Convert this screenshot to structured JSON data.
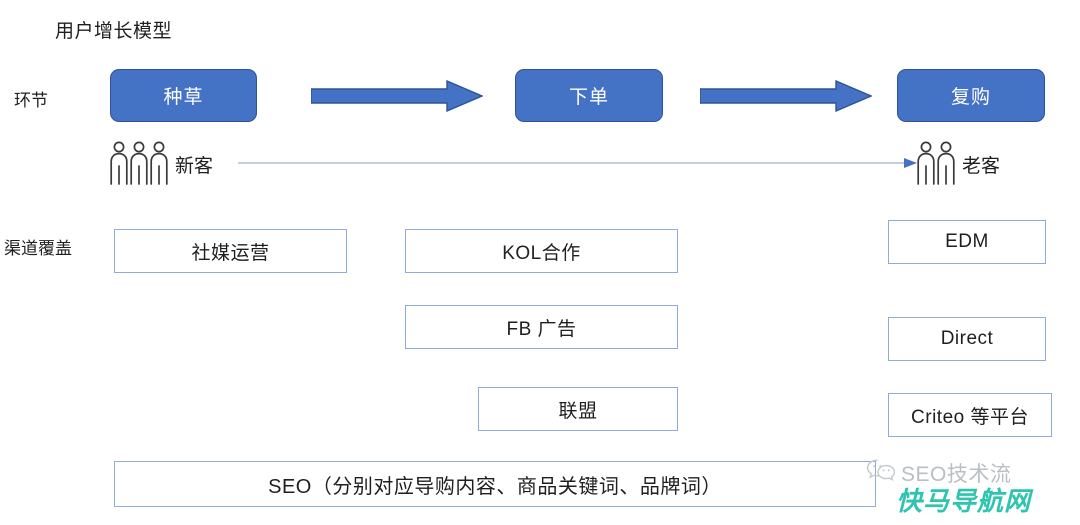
{
  "diagram": {
    "title": "用户增长模型",
    "row_labels": {
      "stage": "环节",
      "channel": "渠道覆盖"
    },
    "stages": [
      {
        "label": "种草"
      },
      {
        "label": "下单"
      },
      {
        "label": "复购"
      }
    ],
    "audience": [
      {
        "label": "新客",
        "count": 3
      },
      {
        "label": "老客",
        "count": 2
      }
    ],
    "channels": {
      "column_1": [
        {
          "label": "社媒运营"
        }
      ],
      "column_2": [
        {
          "label": "KOL合作"
        },
        {
          "label": "FB 广告"
        },
        {
          "label": "联盟"
        }
      ],
      "column_3": [
        {
          "label": "EDM"
        },
        {
          "label": "Direct"
        },
        {
          "label": "Criteo 等平台"
        }
      ],
      "full_width": [
        {
          "label": "SEO（分别对应导购内容、商品关键词、品牌词）"
        }
      ]
    },
    "colors": {
      "stage_fill": "#4472C4",
      "stage_border": "#2F5496",
      "arrow_fill": "#4472C4",
      "arrow_border": "#2F5496",
      "box_border": "#8FAADC",
      "thin_line": "#AFBEDB",
      "text": "#1F1F1F"
    }
  },
  "watermark": {
    "brand": "SEO技术流",
    "site": "快马导航网",
    "icon": "wechat-icon",
    "brand_color": "#B9BFC4",
    "site_color": "#2EC4B0"
  }
}
